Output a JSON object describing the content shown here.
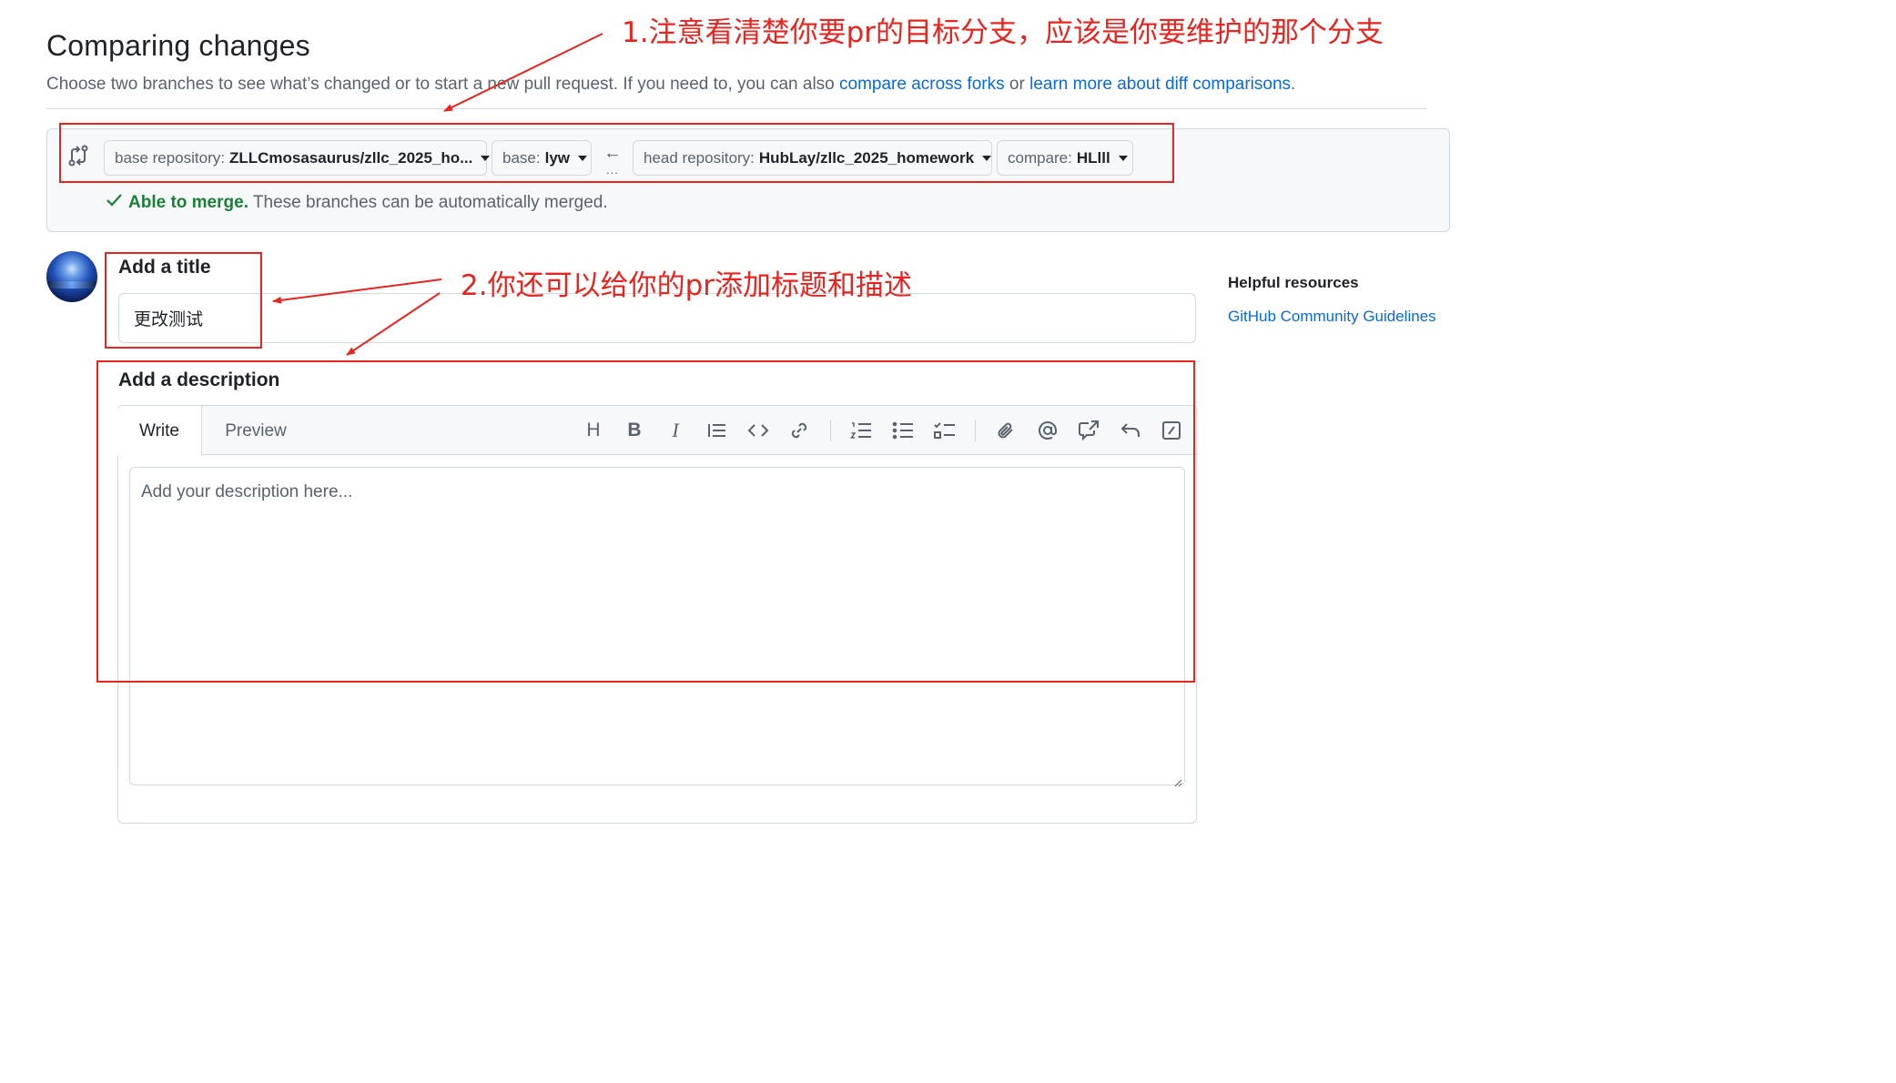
{
  "header": {
    "title": "Comparing changes",
    "subtitle_prefix": "Choose two branches to see what’s changed or to start a new pull request. If you need to, you can also ",
    "compare_forks_link": "compare across forks",
    "or_text": " or ",
    "learn_more_link": "learn more about diff comparisons",
    "period": "."
  },
  "range": {
    "base_repo_label": "base repository:",
    "base_repo_value": "ZLLCmosasaurus/zllc_2025_ho...",
    "base_label": "base:",
    "base_value": "lyw",
    "arrow": "←",
    "dots": "...",
    "head_repo_label": "head repository:",
    "head_repo_value": "HubLay/zllc_2025_homework",
    "compare_label": "compare:",
    "compare_value": "HLlll",
    "merge_status": "Able to merge.",
    "merge_detail": " These branches can be automatically merged."
  },
  "form": {
    "title_label": "Add a title",
    "title_value": "更改测试",
    "description_label": "Add a description",
    "tab_write": "Write",
    "tab_preview": "Preview",
    "description_placeholder": "Add your description here..."
  },
  "toolbar_icons": [
    "heading-icon",
    "bold-icon",
    "italic-icon",
    "quote-icon",
    "code-icon",
    "link-icon",
    "ordered-list-icon",
    "unordered-list-icon",
    "task-list-icon",
    "attach-icon",
    "mention-icon",
    "cross-reference-icon",
    "saved-replies-icon",
    "slash-commands-icon"
  ],
  "sidebar": {
    "title": "Helpful resources",
    "link": "GitHub Community Guidelines"
  },
  "annotations": {
    "note1": "1.注意看清楚你要pr的目标分支，应该是你要维护的那个分支",
    "note2": "2.你还可以给你的pr添加标题和描述",
    "color": "#e5251f"
  },
  "colors": {
    "link": "#0969da",
    "success": "#1a7f37",
    "muted": "#59636e",
    "border": "#d1d9e0",
    "canvas_subtle": "#f6f8fa"
  }
}
